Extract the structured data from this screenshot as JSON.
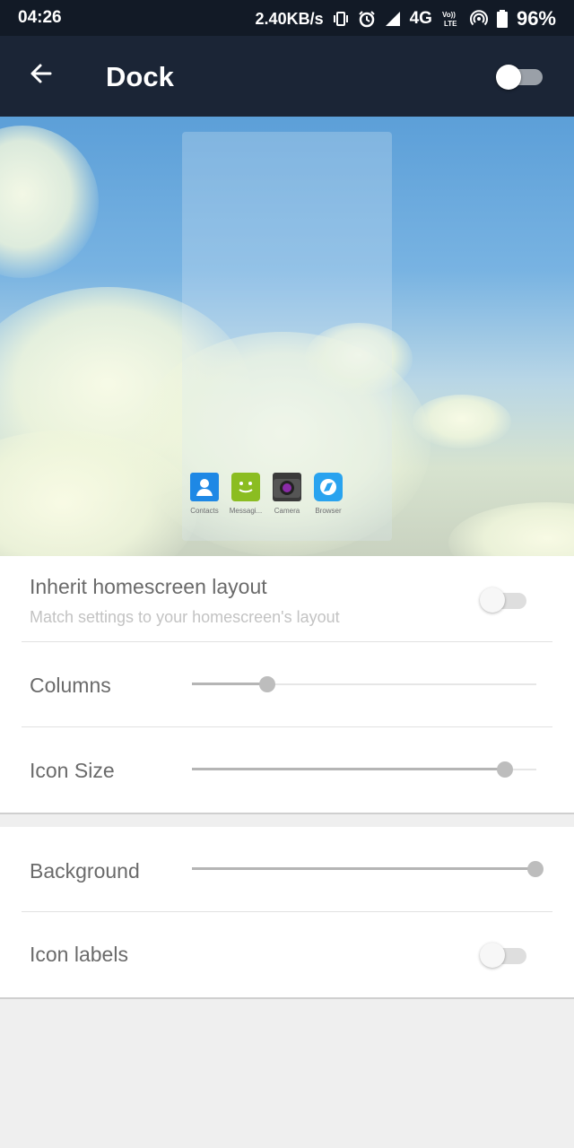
{
  "status_bar": {
    "time": "04:26",
    "net_speed": "2.40KB/s",
    "network": "4G",
    "volte": "Vo)) LTE",
    "battery": "96%",
    "icons": [
      "vibrate-icon",
      "alarm-icon",
      "signal-icon",
      "volte-icon",
      "hotspot-icon",
      "battery-icon"
    ]
  },
  "app_bar": {
    "title": "Dock",
    "back_icon": "arrow-back-icon",
    "master_toggle_on": false
  },
  "preview": {
    "dock_apps": [
      {
        "label": "Contacts",
        "icon": "contacts-icon",
        "color": "#1e88e5"
      },
      {
        "label": "Messagi...",
        "icon": "messaging-icon",
        "color": "#8bbd21"
      },
      {
        "label": "Camera",
        "icon": "camera-icon",
        "color": "#3a3a3a"
      },
      {
        "label": "Browser",
        "icon": "browser-icon",
        "color": "#29a3ef"
      }
    ]
  },
  "settings": {
    "inherit": {
      "title": "Inherit homescreen layout",
      "subtitle": "Match settings to your homescreen's layout",
      "enabled": false
    },
    "columns": {
      "label": "Columns",
      "level": 0.22
    },
    "icon_size": {
      "label": "Icon Size",
      "level": 0.91
    },
    "background": {
      "label": "Background",
      "level": 1.0
    },
    "icon_labels": {
      "label": "Icon labels",
      "enabled": false
    }
  },
  "colors": {
    "status_bar": "#121a26",
    "app_bar": "#1b2536",
    "page_bg": "#efefef"
  }
}
